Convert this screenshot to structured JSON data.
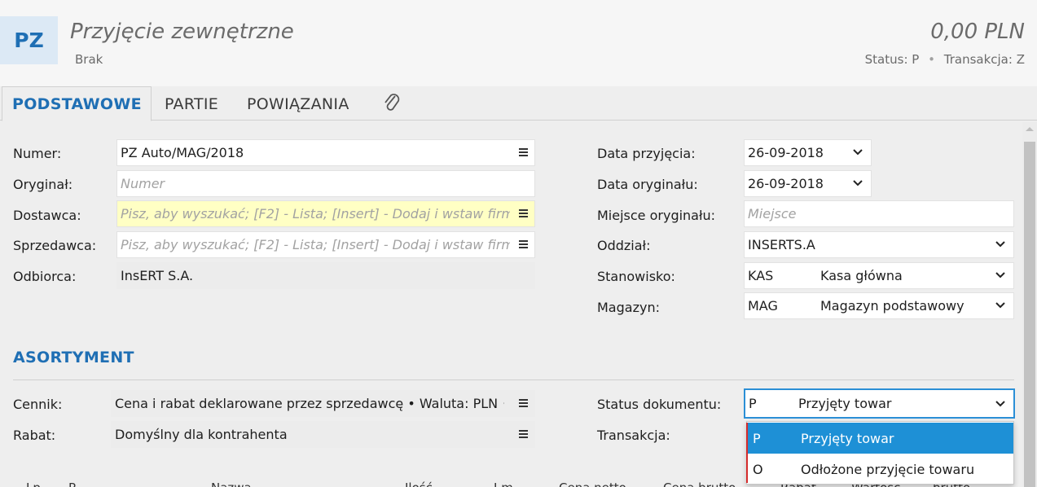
{
  "header": {
    "badge": "PZ",
    "title": "Przyjęcie zewnętrzne",
    "subtitle": "Brak",
    "amount": "0,00 PLN",
    "status_label": "Status:",
    "status_value": "P",
    "transaction_label": "Transakcja:",
    "transaction_value": "Z"
  },
  "tabs": [
    {
      "label": "PODSTAWOWE",
      "active": true
    },
    {
      "label": "PARTIE",
      "active": false
    },
    {
      "label": "POWIĄZANIA",
      "active": false
    }
  ],
  "attachment_icon": "paperclip-icon",
  "left_form": {
    "numer_label": "Numer:",
    "numer_value": "PZ Auto/MAG/2018",
    "oryginal_label": "Oryginał:",
    "oryginal_placeholder": "Numer",
    "dostawca_label": "Dostawca:",
    "dostawca_placeholder": "Pisz, aby wyszukać; [F2] - Lista; [Insert] - Dodaj i wstaw firmę;",
    "sprzedawca_label": "Sprzedawca:",
    "sprzedawca_placeholder": "Pisz, aby wyszukać; [F2] - Lista; [Insert] - Dodaj i wstaw firmę;",
    "odbiorca_label": "Odbiorca:",
    "odbiorca_value": "InsERT S.A."
  },
  "right_form": {
    "data_przyjecia_label": "Data przyjęcia:",
    "data_przyjecia_value": "26-09-2018",
    "data_oryginalu_label": "Data oryginału:",
    "data_oryginalu_value": "26-09-2018",
    "miejsce_label": "Miejsce oryginału:",
    "miejsce_placeholder": "Miejsce",
    "oddzial_label": "Oddział:",
    "oddzial_value": "INSERTS.A",
    "stanowisko_label": "Stanowisko:",
    "stanowisko_code": "KAS",
    "stanowisko_name": "Kasa główna",
    "magazyn_label": "Magazyn:",
    "magazyn_code": "MAG",
    "magazyn_name": "Magazyn podstawowy"
  },
  "asortyment": {
    "title": "ASORTYMENT",
    "cennik_label": "Cennik:",
    "cennik_value": "Cena i rabat deklarowane przez sprzedawcę • Waluta: PLN •",
    "rabat_label": "Rabat:",
    "rabat_value": "Domyślny dla kontrahenta",
    "status_label": "Status dokumentu:",
    "status_code": "P",
    "status_name": "Przyjęty towar",
    "transakcja_label": "Transakcja:"
  },
  "status_dropdown": {
    "options": [
      {
        "code": "P",
        "name": "Przyjęty towar",
        "selected": true
      },
      {
        "code": "O",
        "name": "Odłożone przyjęcie towaru",
        "selected": false
      }
    ]
  },
  "table_columns": [
    "Lp.",
    "P",
    "Nazwa",
    "Ilość",
    "J.m.",
    "Cena netto",
    "Cena brutto",
    "Rabat",
    "Wartość",
    "brutto"
  ],
  "colors": {
    "accent": "#1f6fb4",
    "selected_bg": "#1e90d6",
    "highlight_field": "#ffffc4",
    "error_accent": "#d52b2b"
  }
}
